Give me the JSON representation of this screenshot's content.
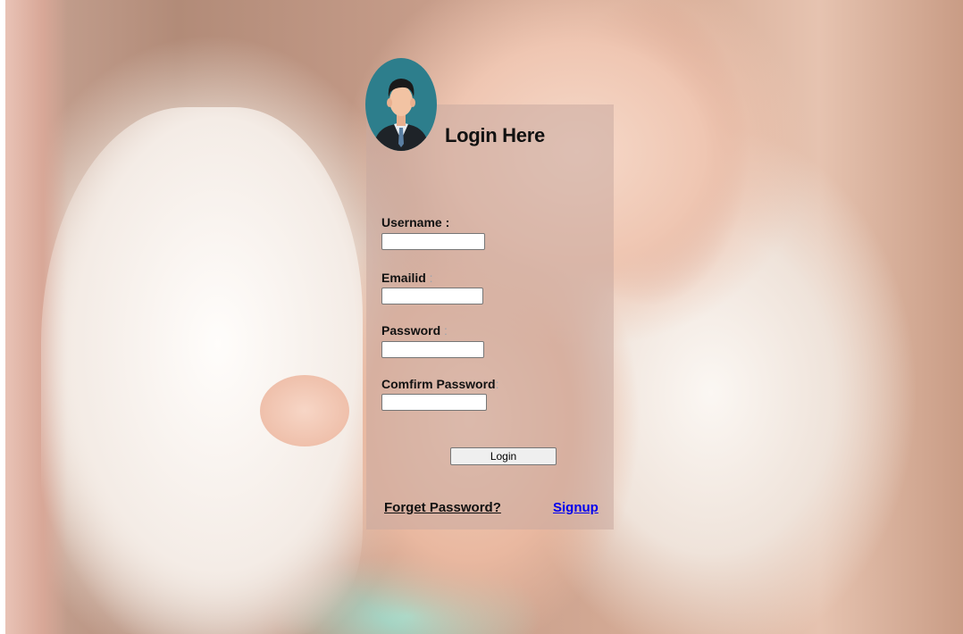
{
  "login": {
    "title": "Login Here",
    "username_label": "Username",
    "username_colon": " :",
    "email_label": "Emailid",
    "email_colon": " :",
    "password_label": "Password",
    "password_colon": " :",
    "confirm_label": "Comfirm Password",
    "confirm_colon": ":",
    "username_value": "",
    "email_value": "",
    "password_value": "",
    "confirm_value": "",
    "login_button": "Login",
    "forget_link": "Forget Password?",
    "signup_link": "Signup"
  },
  "icons": {
    "avatar": "user-avatar-icon"
  },
  "colors": {
    "avatar_bg": "#2d7e8c",
    "link": "#0000ee",
    "panel": "rgba(200,170,160,0.55)"
  }
}
